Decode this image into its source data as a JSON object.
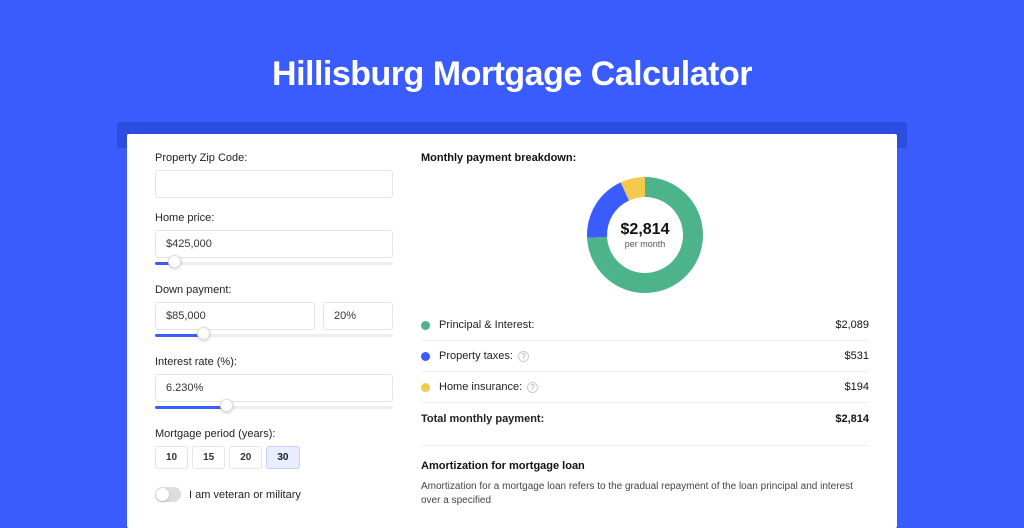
{
  "title": "Hillisburg Mortgage Calculator",
  "form": {
    "zip_label": "Property Zip Code:",
    "zip_value": "",
    "homeprice_label": "Home price:",
    "homeprice_value": "$425,000",
    "homeprice_slider_pct": 8,
    "downpay_label": "Down payment:",
    "downpay_amount": "$85,000",
    "downpay_pct": "20%",
    "downpay_slider_pct": 20,
    "rate_label": "Interest rate (%):",
    "rate_value": "6.230%",
    "rate_slider_pct": 30,
    "period_label": "Mortgage period (years):",
    "periods": [
      "10",
      "15",
      "20",
      "30"
    ],
    "period_active_index": 3,
    "veteran_label": "I am veteran or military"
  },
  "breakdown": {
    "heading": "Monthly payment breakdown:",
    "center_amount": "$2,814",
    "center_sub": "per month",
    "items": [
      {
        "label": "Principal & Interest:",
        "amount": "$2,089",
        "color": "#4cb38a",
        "help": false
      },
      {
        "label": "Property taxes:",
        "amount": "$531",
        "color": "#3a5cff",
        "help": true
      },
      {
        "label": "Home insurance:",
        "amount": "$194",
        "color": "#f2c94c",
        "help": true
      }
    ],
    "total_label": "Total monthly payment:",
    "total_amount": "$2,814"
  },
  "chart_data": {
    "type": "pie",
    "title": "Monthly payment breakdown",
    "unit": "USD/month",
    "series": [
      {
        "name": "Principal & Interest",
        "value": 2089,
        "color": "#4cb38a"
      },
      {
        "name": "Property taxes",
        "value": 531,
        "color": "#3a5cff"
      },
      {
        "name": "Home insurance",
        "value": 194,
        "color": "#f2c94c"
      }
    ],
    "total": 2814
  },
  "amort": {
    "heading": "Amortization for mortgage loan",
    "text": "Amortization for a mortgage loan refers to the gradual repayment of the loan principal and interest over a specified"
  }
}
